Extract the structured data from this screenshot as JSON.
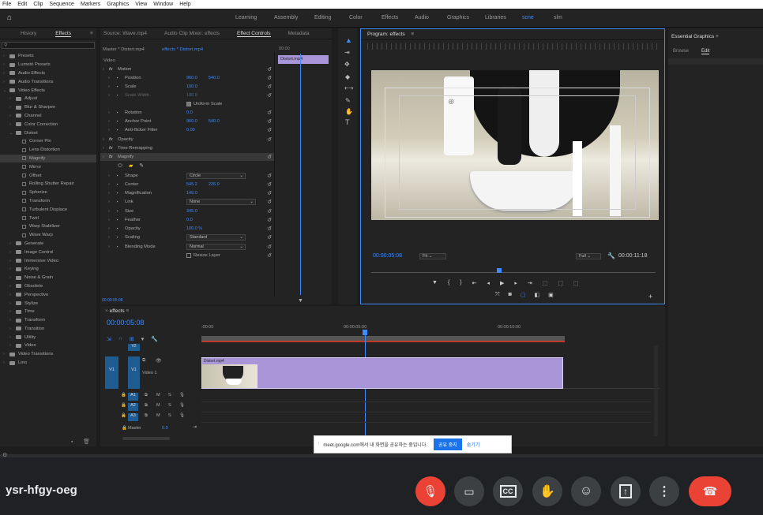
{
  "menu": [
    "File",
    "Edit",
    "Clip",
    "Sequence",
    "Markers",
    "Graphics",
    "View",
    "Window",
    "Help"
  ],
  "workspaces": [
    "Learning",
    "Assembly",
    "Editing",
    "Color",
    "Effects",
    "Audio",
    "Graphics",
    "Libraries",
    "scne",
    "slm"
  ],
  "left_panel": {
    "tabs": [
      "History",
      "Effects"
    ],
    "items": [
      {
        "label": "Presets",
        "type": "folder",
        "indent": 0
      },
      {
        "label": "Lumetri Presets",
        "type": "folder",
        "indent": 0
      },
      {
        "label": "Audio Effects",
        "type": "folder",
        "indent": 0
      },
      {
        "label": "Audio Transitions",
        "type": "folder",
        "indent": 0
      },
      {
        "label": "Video Effects",
        "type": "folder",
        "indent": 0,
        "open": true
      },
      {
        "label": "Adjust",
        "type": "folder",
        "indent": 1
      },
      {
        "label": "Blur & Sharpen",
        "type": "folder",
        "indent": 1
      },
      {
        "label": "Channel",
        "type": "folder",
        "indent": 1
      },
      {
        "label": "Color Correction",
        "type": "folder",
        "indent": 1
      },
      {
        "label": "Distort",
        "type": "folder",
        "indent": 1,
        "open": true
      },
      {
        "label": "Corner Pin",
        "type": "fx",
        "indent": 2
      },
      {
        "label": "Lens Distortion",
        "type": "fx",
        "indent": 2
      },
      {
        "label": "Magnify",
        "type": "fx",
        "indent": 2,
        "selected": true
      },
      {
        "label": "Mirror",
        "type": "fx",
        "indent": 2
      },
      {
        "label": "Offset",
        "type": "fx",
        "indent": 2
      },
      {
        "label": "Rolling Shutter Repair",
        "type": "fx",
        "indent": 2
      },
      {
        "label": "Spherize",
        "type": "fx",
        "indent": 2
      },
      {
        "label": "Transform",
        "type": "fx",
        "indent": 2
      },
      {
        "label": "Turbulent Displace",
        "type": "fx",
        "indent": 2
      },
      {
        "label": "Twirl",
        "type": "fx",
        "indent": 2
      },
      {
        "label": "Warp Stabilizer",
        "type": "fx",
        "indent": 2
      },
      {
        "label": "Wave Warp",
        "type": "fx",
        "indent": 2
      },
      {
        "label": "Generate",
        "type": "folder",
        "indent": 1
      },
      {
        "label": "Image Control",
        "type": "folder",
        "indent": 1
      },
      {
        "label": "Immersive Video",
        "type": "folder",
        "indent": 1
      },
      {
        "label": "Keying",
        "type": "folder",
        "indent": 1
      },
      {
        "label": "Noise & Grain",
        "type": "folder",
        "indent": 1
      },
      {
        "label": "Obsolete",
        "type": "folder",
        "indent": 1
      },
      {
        "label": "Perspective",
        "type": "folder",
        "indent": 1
      },
      {
        "label": "Stylize",
        "type": "folder",
        "indent": 1
      },
      {
        "label": "Time",
        "type": "folder",
        "indent": 1
      },
      {
        "label": "Transform",
        "type": "folder",
        "indent": 1
      },
      {
        "label": "Transition",
        "type": "folder",
        "indent": 1
      },
      {
        "label": "Utility",
        "type": "folder",
        "indent": 1
      },
      {
        "label": "Video",
        "type": "folder",
        "indent": 1
      },
      {
        "label": "Video Transitions",
        "type": "folder",
        "indent": 0
      },
      {
        "label": "Lino",
        "type": "folder",
        "indent": 0
      }
    ]
  },
  "effect_controls": {
    "tabs": [
      "Source: Wave.mp4",
      "Audio Clip Mixer: effects",
      "Effect Controls",
      "Metadata"
    ],
    "master": "Master * Distort.mp4",
    "sequence": "effects * Distort.mp4",
    "clip_label": "Distort.mp4",
    "timecode": "00:00",
    "section_video": "Video",
    "rows": {
      "motion": "Motion",
      "position": "Position",
      "position_x": "960.0",
      "position_y": "540.0",
      "scale": "Scale",
      "scale_v": "100.0",
      "scale_width": "Scale Width",
      "scale_width_v": "100.0",
      "uniform_scale": "Uniform Scale",
      "rotation": "Rotation",
      "rotation_v": "0.0",
      "anchor": "Anchor Point",
      "anchor_x": "960.0",
      "anchor_y": "540.0",
      "antiflicker": "Anti-flicker Filter",
      "antiflicker_v": "0.00",
      "opacity": "Opacity",
      "time_remap": "Time Remapping",
      "magnify": "Magnify",
      "shape": "Shape",
      "shape_v": "Circle",
      "center": "Center",
      "center_x": "545.2",
      "center_y": "226.9",
      "magnification": "Magnification",
      "magnification_v": "149.0",
      "link": "Link",
      "link_v": "None",
      "size": "Size",
      "size_v": "345.0",
      "feather": "Feather",
      "feather_v": "0.0",
      "opacity2": "Opacity",
      "opacity2_v": "100.0 %",
      "scaling": "Scaling",
      "scaling_v": "Standard",
      "blending": "Blending Mode",
      "blending_v": "Normal",
      "resize": "Resize Layer"
    },
    "footer_time": "00:00:05:08"
  },
  "program": {
    "title": "Program: effects",
    "timecode": "00:00:05:08",
    "fit": "Fit",
    "quality": "Full",
    "duration": "00:00:11:18"
  },
  "essential": {
    "title": "Essential Graphics",
    "tabs": [
      "Browse",
      "Edit"
    ]
  },
  "timeline": {
    "title": "effects",
    "timecode": "00:00:05:08",
    "ruler": [
      ":00:00",
      "00:00:05:00",
      "00:00:10:00"
    ],
    "tracks_v": [
      "V2",
      "V1"
    ],
    "v1_name": "Video 1",
    "tracks_a": [
      "A1",
      "A2",
      "A3"
    ],
    "master": "Master",
    "master_v": "0.0",
    "clip": "Distort.mp4"
  },
  "share_bar": {
    "text": "meet.google.com에서 내 화면을 공유하는 중입니다.",
    "stop": "공유 중지",
    "hide": "숨기기"
  },
  "meet": {
    "code": "ysr-hfgy-oeg"
  }
}
